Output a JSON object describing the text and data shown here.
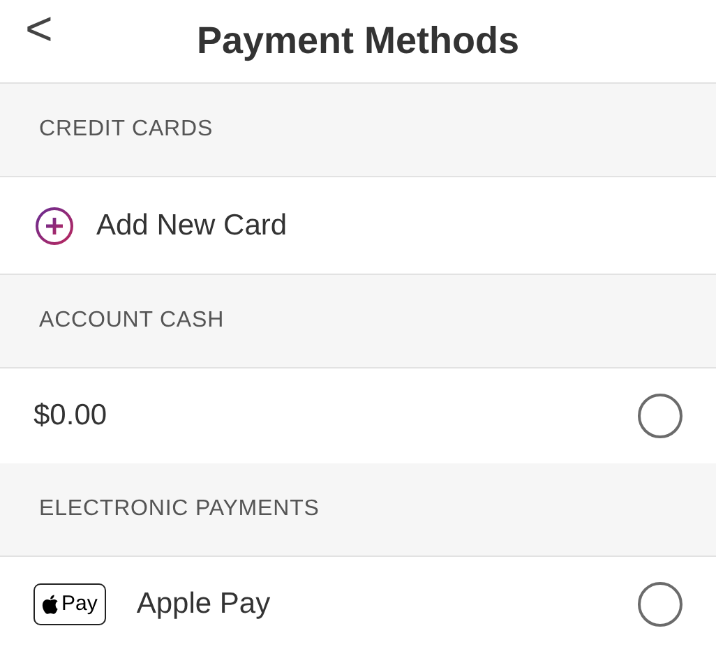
{
  "header": {
    "back": "<",
    "title": "Payment Methods"
  },
  "sections": [
    {
      "title": "CREDIT CARDS",
      "rows": [
        {
          "kind": "add",
          "label": "Add New Card"
        }
      ]
    },
    {
      "title": "ACCOUNT CASH",
      "rows": [
        {
          "kind": "option",
          "label": "$0.00",
          "selected": false
        }
      ]
    },
    {
      "title": "ELECTRONIC PAYMENTS",
      "rows": [
        {
          "kind": "applepay",
          "badge": "Pay",
          "label": "Apple Pay",
          "selected": false
        }
      ]
    }
  ]
}
